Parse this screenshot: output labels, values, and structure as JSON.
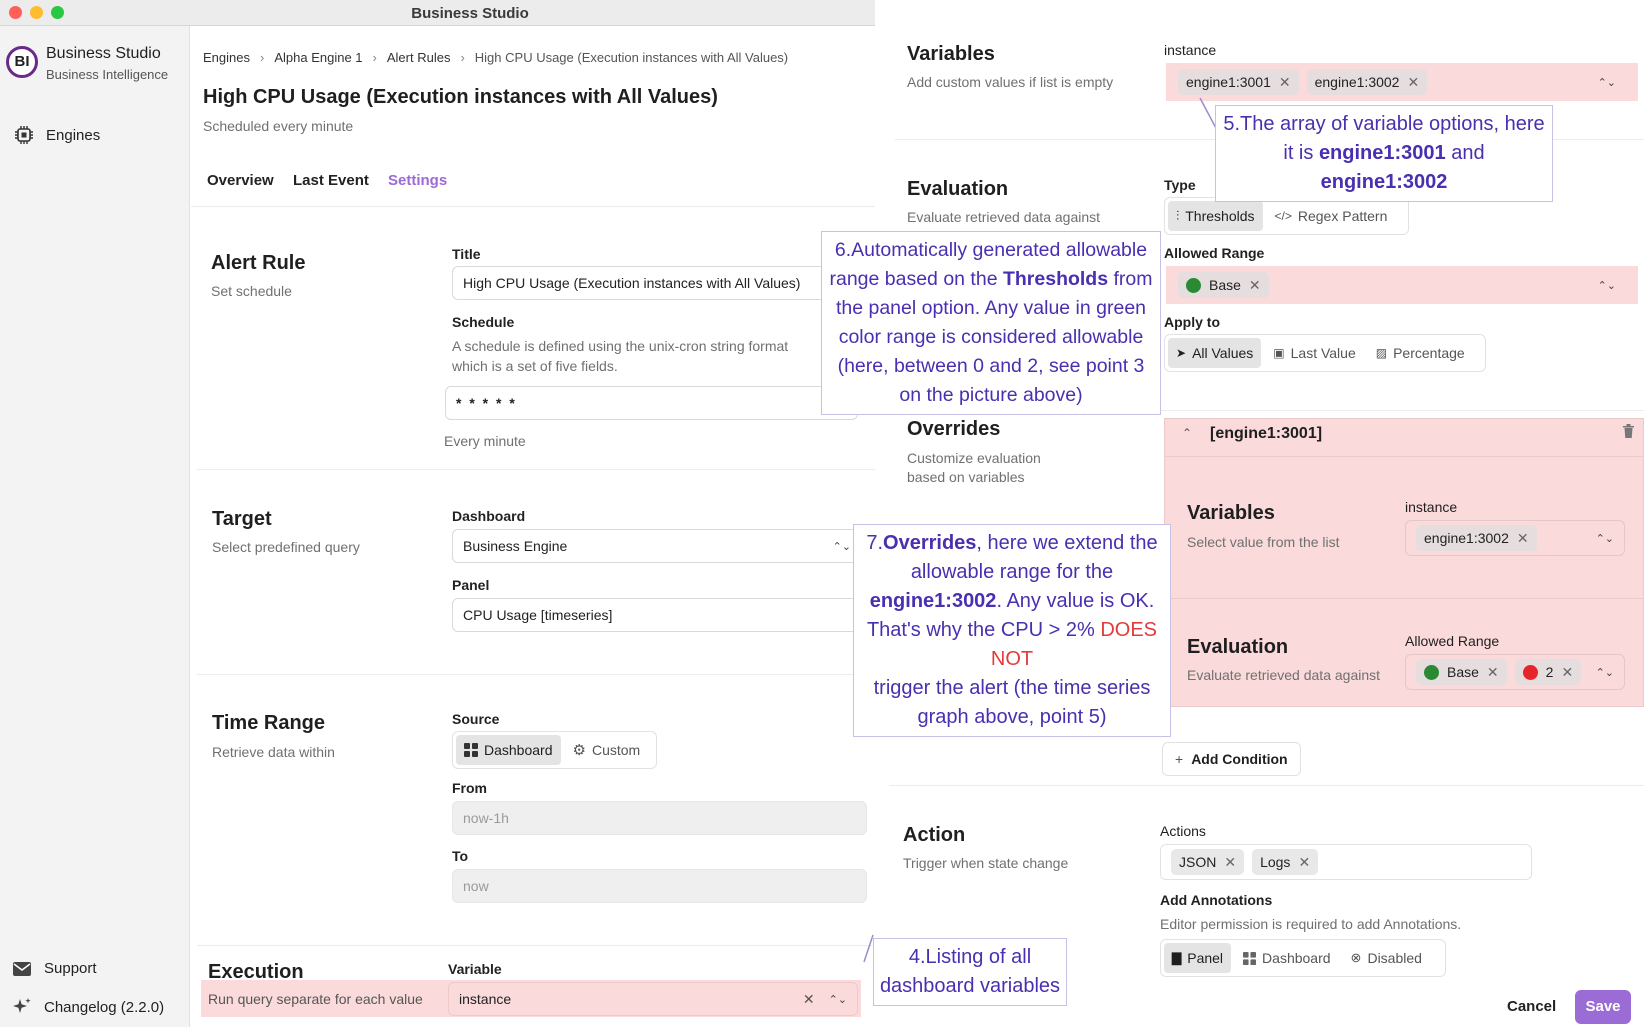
{
  "window": {
    "title": "Business Studio"
  },
  "brand": {
    "name": "Business Studio",
    "subtitle": "Business Intelligence",
    "logo_text": "BI"
  },
  "sidebar": {
    "nav": [
      {
        "label": "Engines",
        "icon": "cpu-icon"
      }
    ],
    "bottom": [
      {
        "label": "Support",
        "icon": "mail-icon"
      },
      {
        "label": "Changelog (2.2.0)",
        "icon": "sparkles-icon"
      }
    ]
  },
  "breadcrumb": [
    "Engines",
    "Alpha Engine 1",
    "Alert Rules",
    "High CPU Usage (Execution instances with All Values)"
  ],
  "page": {
    "title": "High CPU Usage (Execution instances with All Values)",
    "subtitle": "Scheduled every minute"
  },
  "tabs": [
    {
      "label": "Overview",
      "active": false
    },
    {
      "label": "Last Event",
      "active": false
    },
    {
      "label": "Settings",
      "active": true
    }
  ],
  "alert_rule": {
    "heading": "Alert Rule",
    "desc": "Set schedule",
    "title_label": "Title",
    "title_value": "High CPU Usage (Execution instances with All Values)",
    "schedule_label": "Schedule",
    "schedule_help_1": "A schedule is defined using the unix-cron string format",
    "schedule_help_2": "which is a set of five fields.",
    "schedule_value": "* * * * *",
    "schedule_hint": "Every minute"
  },
  "target": {
    "heading": "Target",
    "desc": "Select predefined query",
    "dashboard_label": "Dashboard",
    "dashboard_value": "Business Engine",
    "panel_label": "Panel",
    "panel_value": "CPU Usage [timeseries]"
  },
  "time_range": {
    "heading": "Time Range",
    "desc": "Retrieve data within",
    "source_label": "Source",
    "source_dashboard": "Dashboard",
    "source_custom": "Custom",
    "from_label": "From",
    "from_value": "now-1h",
    "to_label": "To",
    "to_value": "now"
  },
  "execution": {
    "heading": "Execution",
    "desc": "Run query separate for each value",
    "variable_label": "Variable",
    "variable_value": "instance"
  },
  "variables": {
    "heading": "Variables",
    "desc": "Add custom values if list is empty",
    "label": "instance",
    "chips": [
      "engine1:3001",
      "engine1:3002"
    ]
  },
  "evaluation": {
    "heading": "Evaluation",
    "desc": "Evaluate retrieved data against",
    "type_label": "Type",
    "type_thresholds": "Thresholds",
    "type_regex": "Regex Pattern",
    "range_label": "Allowed Range",
    "range_chip": "Base",
    "apply_label": "Apply to",
    "apply_all": "All Values",
    "apply_last": "Last Value",
    "apply_pct": "Percentage"
  },
  "overrides": {
    "heading": "Overrides",
    "desc_1": "Customize evaluation",
    "desc_2": "based on variables",
    "item_title": "[engine1:3001]",
    "var_heading": "Variables",
    "var_desc": "Select value from the list",
    "var_label": "instance",
    "var_chip": "engine1:3002",
    "eval_heading": "Evaluation",
    "eval_desc": "Evaluate retrieved data against",
    "eval_label": "Allowed Range",
    "eval_chip_base": "Base",
    "eval_chip_two": "2",
    "add_condition": "Add Condition"
  },
  "action": {
    "heading": "Action",
    "desc": "Trigger when state change",
    "actions_label": "Actions",
    "chips": [
      "JSON",
      "Logs"
    ],
    "annotations_label": "Add Annotations",
    "annotations_help": "Editor permission is required to add Annotations.",
    "opt_panel": "Panel",
    "opt_dashboard": "Dashboard",
    "opt_disabled": "Disabled"
  },
  "footer": {
    "cancel": "Cancel",
    "save": "Save"
  },
  "callouts": {
    "c4": [
      "4.Listing of all",
      "dashboard variables"
    ],
    "c5a": "5.The array of variable options, here",
    "c5b_pre": "it is ",
    "c5b_v1": "engine1:3001",
    "c5b_mid": " and ",
    "c5b_v2": "engine1:3002",
    "c6_l1": "6.Automatically generated allowable",
    "c6_l2_pre": "range based on the ",
    "c6_l2_b": "Thresholds",
    "c6_l2_post": " from",
    "c6_l3": "the panel option. Any value in green",
    "c6_l4": "color range is considered allowable",
    "c6_l5": "(here, between 0 and 2, see point 3",
    "c6_l6": "on the picture above)",
    "c7_l1_pre": "7.",
    "c7_l1_b": "Overrides",
    "c7_l1_post": ", here we extend the",
    "c7_l2": "allowable range for the",
    "c7_l3_b": "engine1:3002",
    "c7_l3_post": ". Any value is OK.",
    "c7_l4_pre": "That's why the CPU > 2% ",
    "c7_l4_red": "DOES NOT",
    "c7_l5": "trigger the alert (the time series",
    "c7_l6": "graph above, point 5)"
  },
  "colors": {
    "accent": "#9b6bd6",
    "highlight": "#fadada",
    "callout_text": "#4a2fb0",
    "green": "#2a8a34",
    "red": "#e5252a"
  }
}
